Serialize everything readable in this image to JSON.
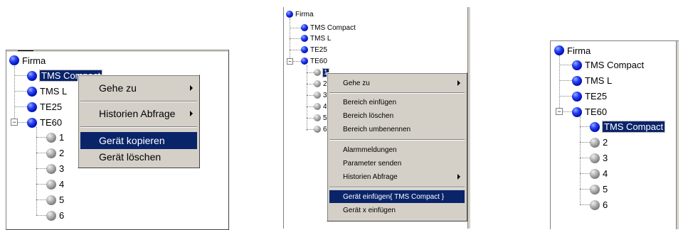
{
  "panel1": {
    "root": "Firma",
    "items": [
      "TMS Compact",
      "TMS L",
      "TE25",
      "TE60"
    ],
    "children": [
      "1",
      "2",
      "3",
      "4",
      "5",
      "6"
    ],
    "menu": {
      "goto": "Gehe zu",
      "history": "Historien Abfrage",
      "copy": "Gerät kopieren",
      "delete": "Gerät löschen"
    }
  },
  "panel2": {
    "root": "Firma",
    "items": [
      "TMS Compact",
      "TMS L",
      "TE25",
      "TE60"
    ],
    "selected_child": "1",
    "children": [
      "2",
      "3",
      "4",
      "5",
      "6"
    ],
    "menu": {
      "goto": "Gehe zu",
      "insert_area": "Bereich einfügen",
      "delete_area": "Bereich löschen",
      "rename_area": "Bereich umbenennen",
      "alarms": "Alarmmeldungen",
      "send_params": "Parameter senden",
      "history": "Historien Abfrage",
      "insert_device": "Gerät einfügen{ TMS Compact }",
      "insert_device_x": "Gerät x einfügen"
    }
  },
  "panel3": {
    "root": "Firma",
    "items": [
      "TMS Compact",
      "TMS L",
      "TE25",
      "TE60"
    ],
    "children": [
      "TMS Compact",
      "2",
      "3",
      "4",
      "5",
      "6"
    ]
  }
}
